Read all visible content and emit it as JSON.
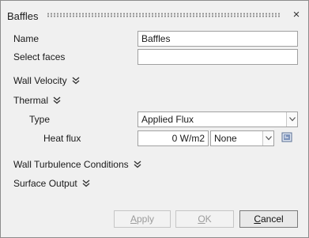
{
  "dialog": {
    "title": "Baffles",
    "close_glyph": "×"
  },
  "fields": {
    "name_label": "Name",
    "name_value": "Baffles",
    "select_faces_label": "Select faces",
    "select_faces_value": ""
  },
  "sections": {
    "wall_velocity": "Wall Velocity",
    "thermal": "Thermal",
    "wall_turbulence": "Wall Turbulence Conditions",
    "surface_output": "Surface Output"
  },
  "thermal": {
    "type_label": "Type",
    "type_value": "Applied Flux",
    "heat_flux_label": "Heat flux",
    "heat_flux_value": "0 W/m2",
    "heat_flux_profile": "None"
  },
  "buttons": {
    "apply": "Apply",
    "ok": "OK",
    "cancel": "Cancel"
  },
  "icons": {
    "close": "close-icon",
    "expand": "double-chevron-down-icon",
    "dropdown": "chevron-down-icon",
    "parameter": "parameter-editor-icon"
  }
}
